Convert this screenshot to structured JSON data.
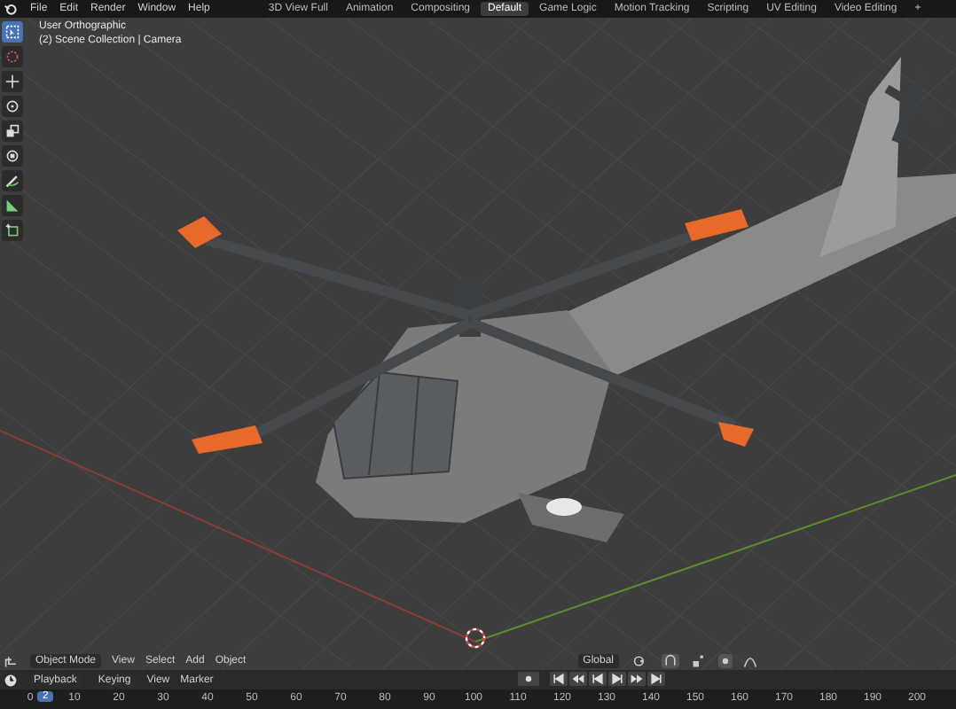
{
  "menu": [
    "File",
    "Edit",
    "Render",
    "Window",
    "Help"
  ],
  "workspace_tabs": [
    {
      "label": "3D View Full",
      "selected": false
    },
    {
      "label": "Animation",
      "selected": false
    },
    {
      "label": "Compositing",
      "selected": false
    },
    {
      "label": "Default",
      "selected": true
    },
    {
      "label": "Game Logic",
      "selected": false
    },
    {
      "label": "Motion Tracking",
      "selected": false
    },
    {
      "label": "Scripting",
      "selected": false
    },
    {
      "label": "UV Editing",
      "selected": false
    },
    {
      "label": "Video Editing",
      "selected": false
    }
  ],
  "add_tab": "+",
  "viewport": {
    "view_name": "User Orthographic",
    "collection_info": "(2) Scene Collection | Camera"
  },
  "tools": [
    {
      "kind": "select",
      "selected": true
    },
    {
      "kind": "cursor",
      "selected": false
    },
    {
      "kind": "move",
      "selected": false
    },
    {
      "kind": "rotate",
      "selected": false
    },
    {
      "kind": "scale",
      "selected": false
    },
    {
      "kind": "transform",
      "selected": false
    },
    {
      "kind": "annotate",
      "selected": false
    },
    {
      "kind": "measure",
      "selected": false
    },
    {
      "kind": "add-cube",
      "selected": false
    }
  ],
  "viewport_header": {
    "mode": "Object Mode",
    "menus": [
      "View",
      "Select",
      "Add",
      "Object"
    ],
    "orientation": "Global"
  },
  "timeline_header": {
    "menus": [
      "Playback",
      "Keying"
    ],
    "plain_menus": [
      "View",
      "Marker"
    ]
  },
  "ruler": {
    "current_frame": "2",
    "ticks": [
      "0",
      "10",
      "20",
      "30",
      "40",
      "50",
      "60",
      "70",
      "80",
      "90",
      "100",
      "110",
      "120",
      "130",
      "140",
      "150",
      "160",
      "170",
      "180",
      "190",
      "200"
    ]
  }
}
